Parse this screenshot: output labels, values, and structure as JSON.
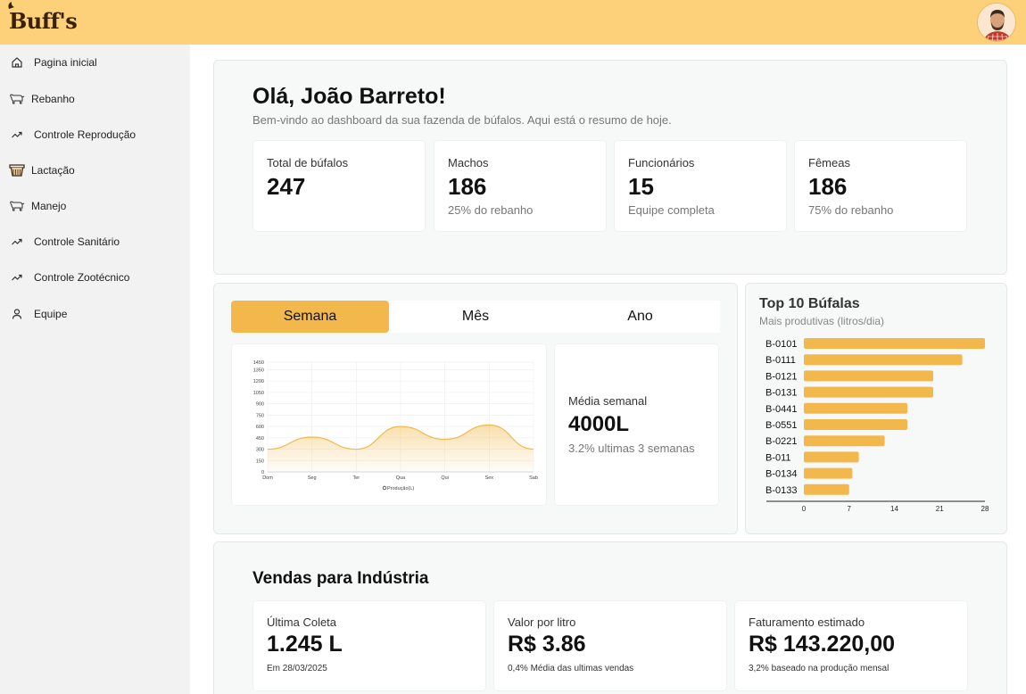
{
  "app": {
    "logo_text": "Buff's",
    "accent_color": "#FDD07A",
    "highlight_color": "#F2B84B"
  },
  "sidebar": {
    "items": [
      {
        "label": "Pagina inicial",
        "icon": "home-icon"
      },
      {
        "label": "Rebanho",
        "icon": "buffalo-icon"
      },
      {
        "label": "Controle Reprodução",
        "icon": "trend-icon"
      },
      {
        "label": "Lactação",
        "icon": "milk-bucket-icon"
      },
      {
        "label": "Manejo",
        "icon": "buffalo-icon"
      },
      {
        "label": "Controle Sanitário",
        "icon": "trend-icon"
      },
      {
        "label": "Controle Zootécnico",
        "icon": "trend-icon"
      },
      {
        "label": "Equipe",
        "icon": "user-icon"
      }
    ]
  },
  "welcome": {
    "title": "Olá, João Barreto!",
    "subtitle": "Bem-vindo ao dashboard da sua fazenda de búfalos. Aqui está o resumo de hoje."
  },
  "stats": [
    {
      "label": "Total de búfalos",
      "value": "247",
      "sub": ""
    },
    {
      "label": "Machos",
      "value": "186",
      "sub": "25% do rebanho"
    },
    {
      "label": "Funcionários",
      "value": "15",
      "sub": "Equipe completa"
    },
    {
      "label": "Fêmeas",
      "value": "186",
      "sub": "75% do rebanho"
    }
  ],
  "tabs": [
    {
      "label": "Semana",
      "active": true
    },
    {
      "label": "Mês",
      "active": false
    },
    {
      "label": "Ano",
      "active": false
    }
  ],
  "weekly": {
    "label": "Média semanal",
    "value": "4000L",
    "sub": "3.2% ultimas 3 semanas"
  },
  "top10": {
    "title": "Top 10 Búfalas",
    "subtitle": "Mais produtivas (litros/dia)"
  },
  "sales": {
    "title": "Vendas para Indústria",
    "cards": [
      {
        "label": "Última Coleta",
        "value": "1.245 L",
        "sub": "Em 28/03/2025"
      },
      {
        "label": "Valor por litro",
        "value": "R$ 3.86",
        "sub": "0,4% Média das ultimas vendas"
      },
      {
        "label": "Faturamento estimado",
        "value": "R$ 143.220,00",
        "sub": "3,2% baseado na produção mensal"
      }
    ]
  },
  "chart_data": [
    {
      "type": "area",
      "categories": [
        "Dom",
        "Seg",
        "Ter",
        "Qua",
        "Qui",
        "Sex",
        "Sab"
      ],
      "series": [
        {
          "name": "Produção(L)",
          "values": [
            300,
            460,
            300,
            600,
            430,
            620,
            300
          ]
        }
      ],
      "yticks": [
        0,
        150,
        300,
        450,
        600,
        750,
        900,
        1050,
        1200,
        1350,
        1450
      ],
      "ylim": [
        0,
        1450
      ],
      "grid": true,
      "legend": "bottom",
      "color": "#F2B84B"
    },
    {
      "type": "bar",
      "orientation": "horizontal",
      "categories": [
        "B-0101",
        "B-0111",
        "B-0121",
        "B-0131",
        "B-0441",
        "B-0551",
        "B-0221",
        "B-011",
        "B-0134",
        "B-0133"
      ],
      "values": [
        28,
        24.5,
        20,
        20,
        16,
        16,
        12.5,
        8.5,
        7.5,
        7
      ],
      "xticks": [
        0,
        7,
        14,
        21,
        28
      ],
      "xlim": [
        0,
        28
      ],
      "color": "#F2B84B"
    }
  ]
}
